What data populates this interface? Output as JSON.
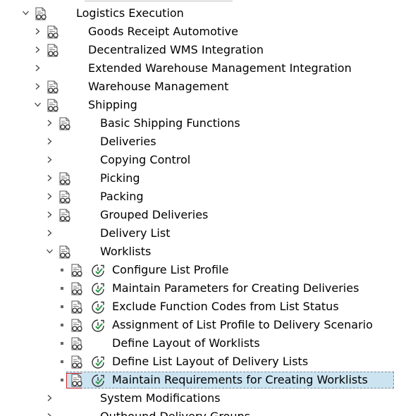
{
  "tree": {
    "root": {
      "label": "Logistics Execution"
    },
    "level1": [
      {
        "label": "Goods Receipt Automotive"
      },
      {
        "label": "Decentralized WMS Integration"
      },
      {
        "label": "Extended Warehouse Management Integration"
      },
      {
        "label": "Warehouse Management"
      },
      {
        "label": "Shipping"
      }
    ],
    "shipping_children": [
      {
        "label": "Basic Shipping Functions"
      },
      {
        "label": "Deliveries"
      },
      {
        "label": "Copying Control"
      },
      {
        "label": "Picking"
      },
      {
        "label": "Packing"
      },
      {
        "label": "Grouped Deliveries"
      },
      {
        "label": "Delivery List"
      },
      {
        "label": "Worklists"
      },
      {
        "label": "System Modifications"
      },
      {
        "label": "Outbound Delivery Groups"
      }
    ],
    "worklists_children": [
      {
        "label": "Configure List Profile"
      },
      {
        "label": "Maintain Parameters for Creating Deliveries"
      },
      {
        "label": "Exclude Function Codes from List Status"
      },
      {
        "label": "Assignment of List Profile to Delivery Scenario"
      },
      {
        "label": "Define Layout of Worklists"
      },
      {
        "label": "Define List Layout of Delivery Lists"
      },
      {
        "label": "Maintain Requirements for Creating Worklists"
      }
    ]
  },
  "colors": {
    "selection": "#cce4f2",
    "clock_accent": "#2e9a4a"
  }
}
